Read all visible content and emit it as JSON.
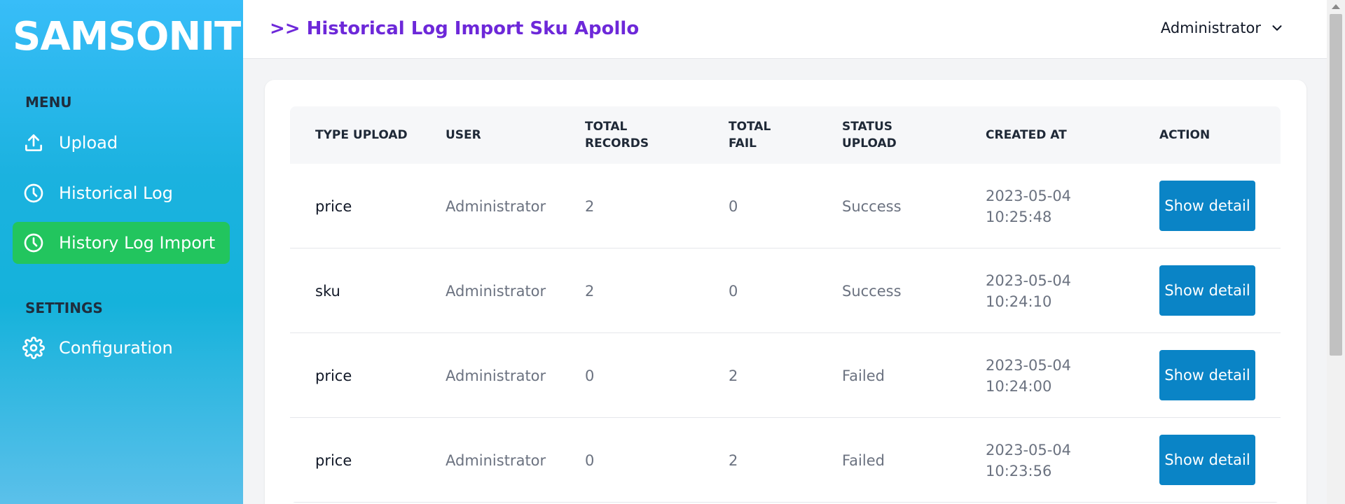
{
  "sidebar": {
    "brand": "SAMSONITE",
    "menu_heading": "MENU",
    "settings_heading": "SETTINGS",
    "items": [
      {
        "label": "Upload",
        "icon": "upload-icon"
      },
      {
        "label": "Historical Log",
        "icon": "clock-icon"
      },
      {
        "label": "History Log Import",
        "icon": "clock-icon",
        "active": true
      },
      {
        "label": "Configuration",
        "icon": "gear-icon"
      }
    ]
  },
  "header": {
    "title": ">> Historical Log Import Sku Apollo",
    "user": "Administrator",
    "user_icon": "chevron-down-icon"
  },
  "table": {
    "columns": [
      "TYPE UPLOAD",
      "USER",
      "TOTAL RECORDS",
      "TOTAL FAIL",
      "STATUS UPLOAD",
      "CREATED AT",
      "ACTION"
    ],
    "rows": [
      {
        "type": "price",
        "user": "Administrator",
        "total_records": "2",
        "total_fail": "0",
        "status": "Success",
        "created_date": "2023-05-04",
        "created_time": "10:25:48",
        "action": "Show detail"
      },
      {
        "type": "sku",
        "user": "Administrator",
        "total_records": "2",
        "total_fail": "0",
        "status": "Success",
        "created_date": "2023-05-04",
        "created_time": "10:24:10",
        "action": "Show detail"
      },
      {
        "type": "price",
        "user": "Administrator",
        "total_records": "0",
        "total_fail": "2",
        "status": "Failed",
        "created_date": "2023-05-04",
        "created_time": "10:24:00",
        "action": "Show detail"
      },
      {
        "type": "price",
        "user": "Administrator",
        "total_records": "0",
        "total_fail": "2",
        "status": "Failed",
        "created_date": "2023-05-04",
        "created_time": "10:23:56",
        "action": "Show detail"
      }
    ]
  },
  "colors": {
    "accent_purple": "#6d28d9",
    "active_green": "#22c55e",
    "button_blue": "#0a84c6",
    "sidebar_blue": "#15b2db"
  }
}
